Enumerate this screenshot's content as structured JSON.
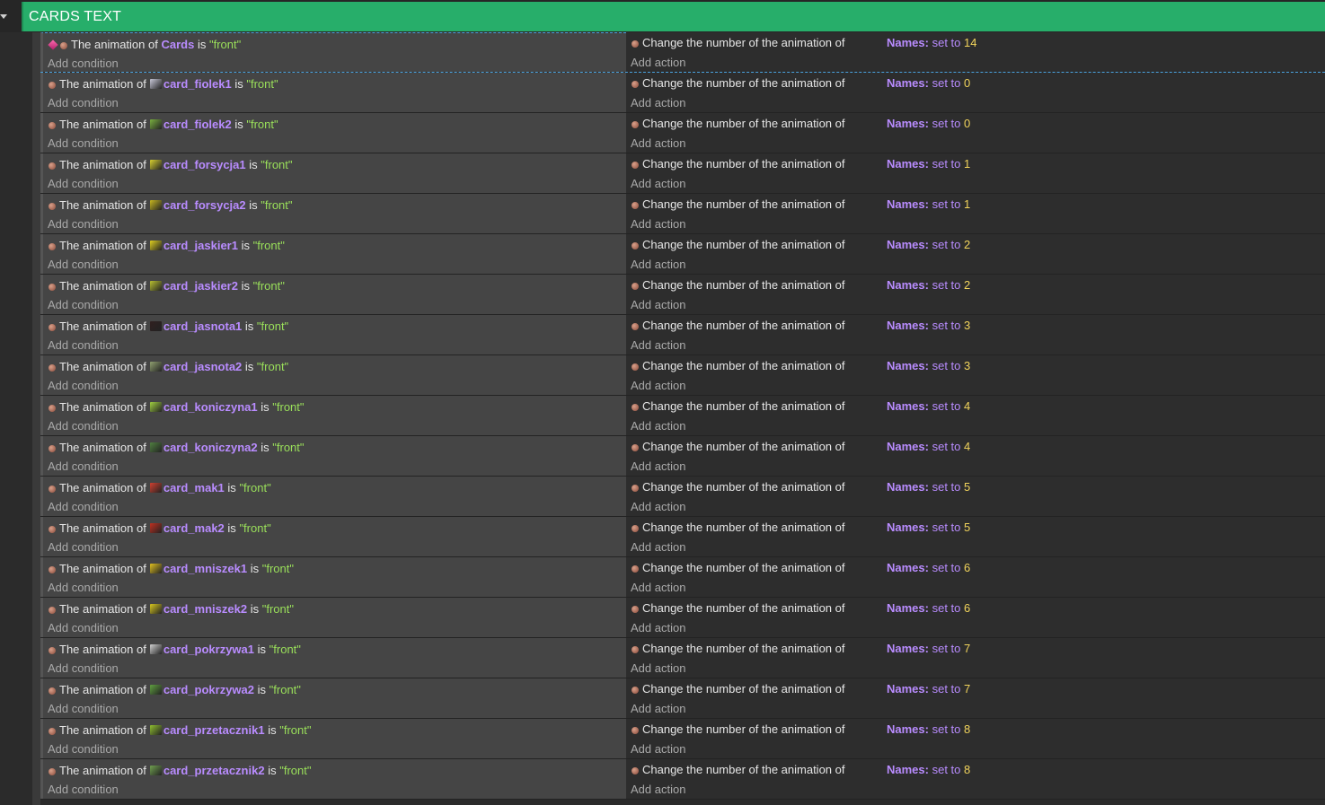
{
  "group": {
    "title": "CARDS TEXT"
  },
  "labels": {
    "animation_of": "The animation of",
    "is": "is",
    "front": "\"front\"",
    "change": "Change the number of the animation of",
    "names": "Names:",
    "set_to": "set to",
    "add_condition": "Add condition",
    "add_action": "Add action"
  },
  "icons": {
    "condition": "animation-icon",
    "action": "animation-icon",
    "cards": "gem-icon"
  },
  "colors": {
    "group_header": "#27ae6a",
    "object": "#b98cff",
    "string": "#9ae05a",
    "number": "#f2d45c"
  },
  "events": [
    {
      "object": "Cards",
      "value": "14",
      "thumb": "#d8407a"
    },
    {
      "object": "card_fiolek1",
      "value": "0",
      "thumb": "#c8c8d8"
    },
    {
      "object": "card_fiolek2",
      "value": "0",
      "thumb": "#7ab040"
    },
    {
      "object": "card_forsycja1",
      "value": "1",
      "thumb": "#d8d030"
    },
    {
      "object": "card_forsycja2",
      "value": "1",
      "thumb": "#c8b820"
    },
    {
      "object": "card_jaskier1",
      "value": "2",
      "thumb": "#e0d020"
    },
    {
      "object": "card_jaskier2",
      "value": "2",
      "thumb": "#b8c030"
    },
    {
      "object": "card_jasnota1",
      "value": "3",
      "thumb": "#302020"
    },
    {
      "object": "card_jasnota2",
      "value": "3",
      "thumb": "#90a070"
    },
    {
      "object": "card_koniczyna1",
      "value": "4",
      "thumb": "#a0d040"
    },
    {
      "object": "card_koniczyna2",
      "value": "4",
      "thumb": "#508040"
    },
    {
      "object": "card_mak1",
      "value": "5",
      "thumb": "#d04030"
    },
    {
      "object": "card_mak2",
      "value": "5",
      "thumb": "#c03020"
    },
    {
      "object": "card_mniszek1",
      "value": "6",
      "thumb": "#e0c020"
    },
    {
      "object": "card_mniszek2",
      "value": "6",
      "thumb": "#d8c820"
    },
    {
      "object": "card_pokrzywa1",
      "value": "7",
      "thumb": "#d0d0d0"
    },
    {
      "object": "card_pokrzywa2",
      "value": "7",
      "thumb": "#60a040"
    },
    {
      "object": "card_przetacznik1",
      "value": "8",
      "thumb": "#90c030"
    },
    {
      "object": "card_przetacznik2",
      "value": "8",
      "thumb": "#70a050"
    }
  ]
}
